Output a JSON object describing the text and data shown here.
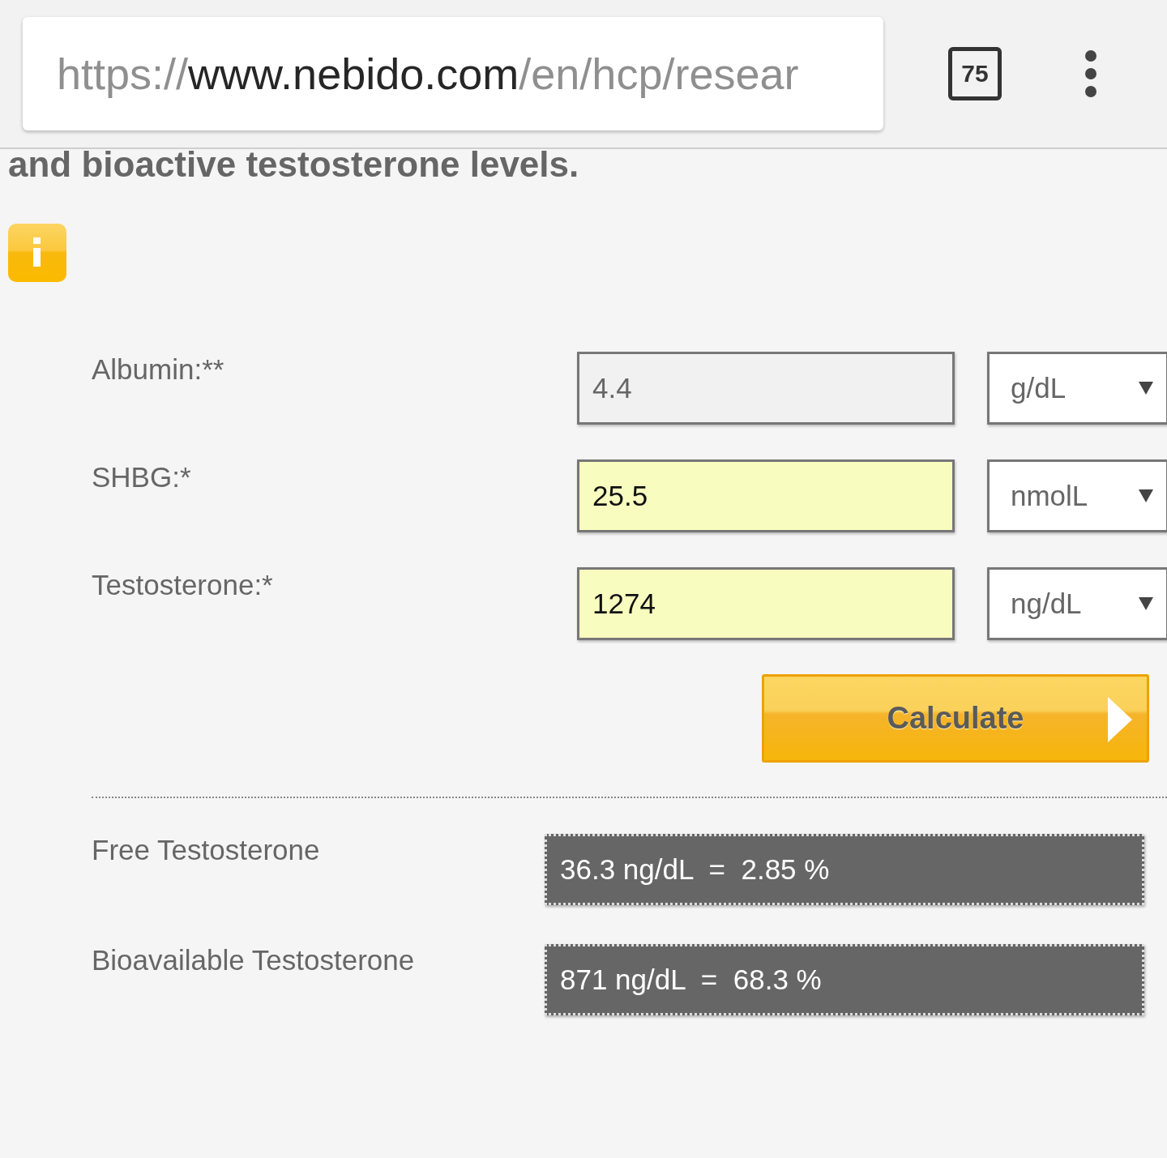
{
  "browser_bar": {
    "url": {
      "scheme": "https://",
      "host": "www.nebido.com",
      "path": "/en/hcp/resear"
    },
    "tab_count": "75"
  },
  "heading": "and bioactive testosterone levels.",
  "inputs": [
    {
      "label": "Albumin:**",
      "value": "4.4",
      "unit": "g/dL",
      "required": false
    },
    {
      "label": "SHBG:*",
      "value": "25.5",
      "unit": "nmolL",
      "required": true
    },
    {
      "label": "Testosterone:*",
      "value": "1274",
      "unit": "ng/dL",
      "required": true
    }
  ],
  "calculate_button": "Calculate",
  "results": [
    {
      "label": "Free Testosterone",
      "value": "36.3 ng/dL  =  2.85 %"
    },
    {
      "label": "Bioavailable Testosterone",
      "value": "871 ng/dL  =  68.3 %"
    }
  ]
}
